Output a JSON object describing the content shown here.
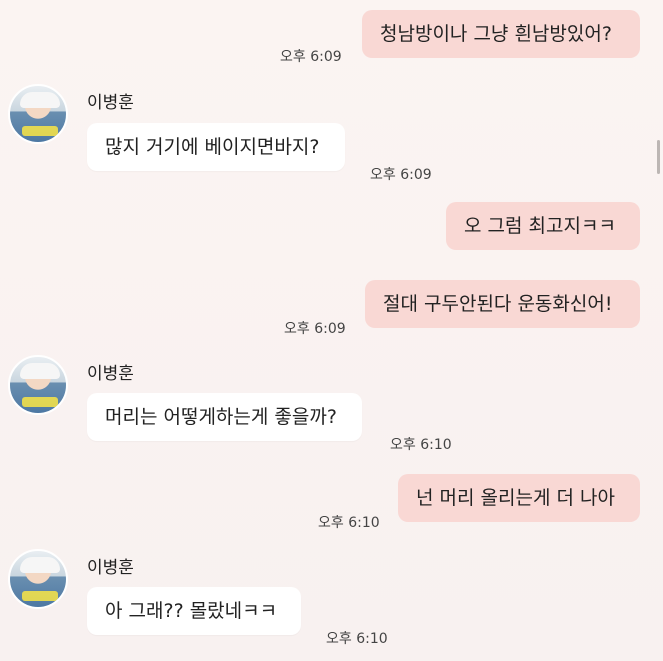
{
  "sender_name": "이병훈",
  "messages": [
    {
      "side": "out",
      "text": "청남방이나 그냥 흰남방있어?",
      "time": "오후 6:09"
    },
    {
      "side": "in",
      "text": "많지 거기에 베이지면바지?",
      "time": "오후 6:09"
    },
    {
      "side": "out",
      "text": "오 그럼 최고지ㅋㅋ",
      "time": ""
    },
    {
      "side": "out",
      "text": "절대 구두안된다 운동화신어!",
      "time": "오후 6:09"
    },
    {
      "side": "in",
      "text": "머리는 어떻게하는게 좋을까?",
      "time": "오후 6:10"
    },
    {
      "side": "out",
      "text": "넌 머리 올리는게 더 나아",
      "time": "오후 6:10"
    },
    {
      "side": "in",
      "text": "아 그래?? 몰랐네ㅋㅋ",
      "time": "오후 6:10"
    }
  ],
  "colors": {
    "outgoing_bubble": "#f9d8d4",
    "incoming_bubble": "#ffffff",
    "background": "#f8f1f0"
  }
}
